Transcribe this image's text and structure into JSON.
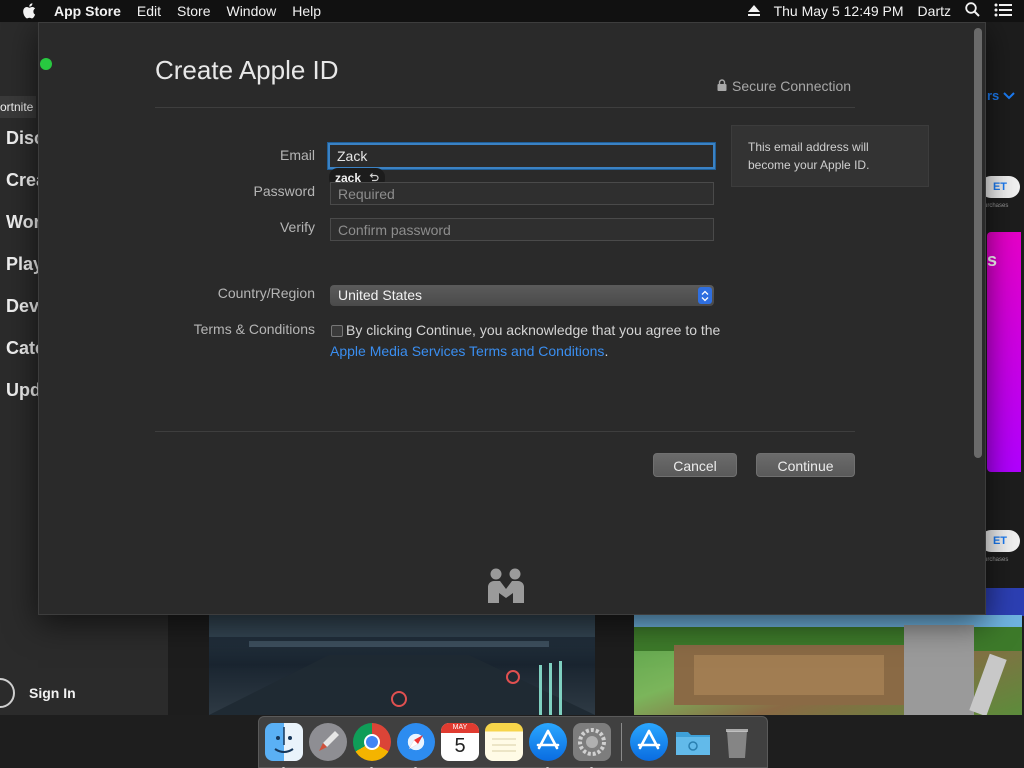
{
  "menubar": {
    "app_name": "App Store",
    "items": [
      "Edit",
      "Store",
      "Window",
      "Help"
    ],
    "datetime": "Thu May 5  12:49 PM",
    "user": "Dartz"
  },
  "sidebar": {
    "tab_label": "ortnite",
    "items": [
      "Disc",
      "Crea",
      "Wor",
      "Play",
      "Dev",
      "Cate",
      "Upd"
    ],
    "sign_in": "Sign In"
  },
  "background": {
    "get_label": "ET",
    "purchase_note": "urchases",
    "promo_text": "s",
    "arrow_text": "rs"
  },
  "dialog": {
    "title": "Create Apple ID",
    "secure_label": "Secure Connection",
    "email_label": "Email",
    "email_value": "Zack",
    "autocomplete_suggestion": "zack",
    "password_label": "Password",
    "password_placeholder": "Required",
    "verify_label": "Verify",
    "verify_placeholder": "Confirm password",
    "country_label": "Country/Region",
    "country_value": "United States",
    "terms_label": "Terms & Conditions",
    "terms_text_1": "By clicking Continue, you acknowledge that you agree to the",
    "terms_link": "Apple Media Services Terms and Conditions",
    "terms_text_2": ".",
    "hint_text": "This email address will become your Apple ID.",
    "cancel_label": "Cancel",
    "continue_label": "Continue"
  },
  "dock": {
    "icons": [
      "finder-icon",
      "launchpad-icon",
      "chrome-icon",
      "safari-icon",
      "calendar-icon",
      "notes-icon",
      "app-store-icon",
      "system-preferences-icon",
      "app-store-downloads-icon",
      "folder-icon",
      "trash-icon"
    ],
    "calendar_month": "MAY",
    "calendar_day": "5"
  },
  "colors": {
    "accent": "#3a8ef0",
    "focus_ring": "#3b82c4",
    "sheet_bg": "#2a2a2a"
  }
}
